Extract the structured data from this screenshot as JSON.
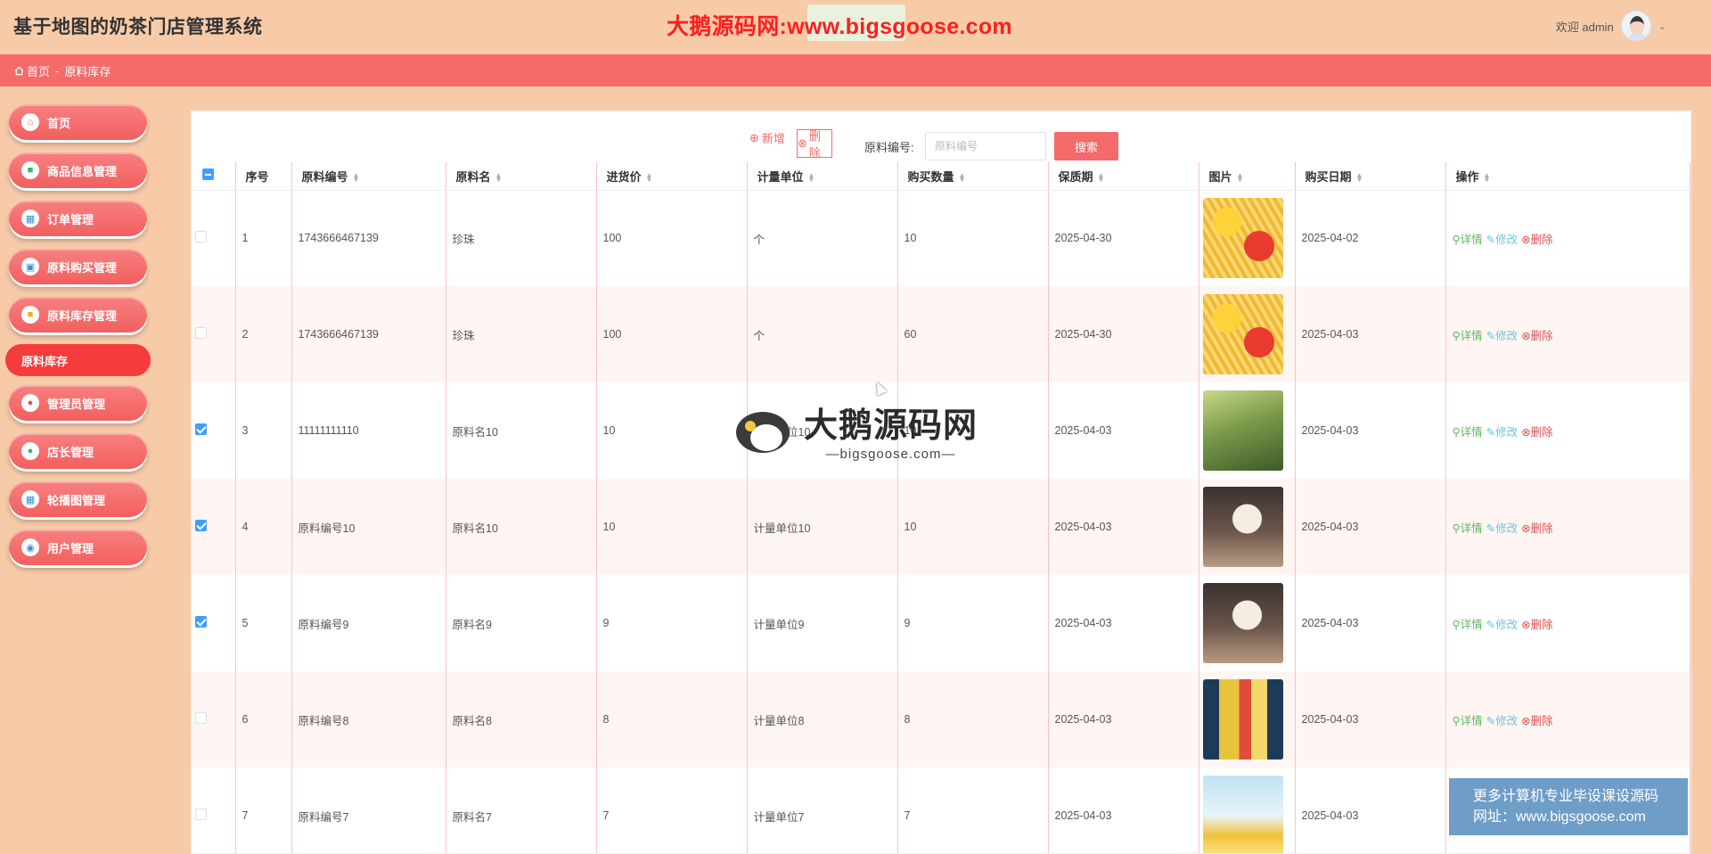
{
  "header": {
    "app_title": "基于地图的奶茶门店管理系统",
    "banner": "大鹅源码网:www.bigsgoose.com",
    "welcome": "欢迎 admin"
  },
  "breadcrumb": {
    "home": "首页",
    "separator": "-",
    "current": "原料库存"
  },
  "sidebar": {
    "items": [
      {
        "label": "首页",
        "icon": "home-icon"
      },
      {
        "label": "商品信息管理",
        "icon": "product-icon"
      },
      {
        "label": "订单管理",
        "icon": "order-icon"
      },
      {
        "label": "原料购买管理",
        "icon": "purchase-icon"
      },
      {
        "label": "原料库存管理",
        "icon": "inventory-icon"
      },
      {
        "label": "管理员管理",
        "icon": "admin-icon"
      },
      {
        "label": "店长管理",
        "icon": "manager-icon"
      },
      {
        "label": "轮播图管理",
        "icon": "carousel-icon"
      },
      {
        "label": "用户管理",
        "icon": "user-icon"
      }
    ],
    "active_sub": "原料库存"
  },
  "toolbar": {
    "add_label": "新增",
    "delete_label": "删除",
    "search_label": "原料编号:",
    "search_placeholder": "原料编号",
    "search_button": "搜索"
  },
  "table": {
    "headers": [
      "序号",
      "原料编号",
      "原料名",
      "进货价",
      "计量单位",
      "购买数量",
      "保质期",
      "图片",
      "购买日期",
      "操作"
    ],
    "rows": [
      {
        "no": "1",
        "code": "1743666467139",
        "name": "珍珠",
        "price": "100",
        "unit": "个",
        "qty": "10",
        "shelf": "2025-04-30",
        "buy_date": "2025-04-02",
        "checked": false,
        "img": "snack"
      },
      {
        "no": "2",
        "code": "1743666467139",
        "name": "珍珠",
        "price": "100",
        "unit": "个",
        "qty": "60",
        "shelf": "2025-04-30",
        "buy_date": "2025-04-03",
        "checked": false,
        "img": "snack"
      },
      {
        "no": "3",
        "code": "11111111110",
        "name": "原料名10",
        "price": "10",
        "unit": "计量单位10",
        "qty": "10",
        "shelf": "2025-04-03",
        "buy_date": "2025-04-03",
        "checked": true,
        "img": "tea-green"
      },
      {
        "no": "4",
        "code": "原料编号10",
        "name": "原料名10",
        "price": "10",
        "unit": "计量单位10",
        "qty": "10",
        "shelf": "2025-04-03",
        "buy_date": "2025-04-03",
        "checked": true,
        "img": "milk-brown"
      },
      {
        "no": "5",
        "code": "原料编号9",
        "name": "原料名9",
        "price": "9",
        "unit": "计量单位9",
        "qty": "9",
        "shelf": "2025-04-03",
        "buy_date": "2025-04-03",
        "checked": true,
        "img": "milk-brown"
      },
      {
        "no": "6",
        "code": "原料编号8",
        "name": "原料名8",
        "price": "8",
        "unit": "计量单位8",
        "qty": "8",
        "shelf": "2025-04-03",
        "buy_date": "2025-04-03",
        "checked": false,
        "img": "fruit-tea"
      },
      {
        "no": "7",
        "code": "原料编号7",
        "name": "原料名7",
        "price": "7",
        "unit": "计量单位7",
        "qty": "7",
        "shelf": "2025-04-03",
        "buy_date": "2025-04-03",
        "checked": false,
        "img": "lemon-tea"
      }
    ],
    "ops": {
      "detail": "详情",
      "edit": "修改",
      "delete": "删除"
    }
  },
  "watermark": {
    "title": "大鹅源码网",
    "url": "—bigsgoose.com—"
  },
  "promo": {
    "line1": "更多计算机专业毕设课设源码",
    "line2": "网址：www.bigsgoose.com"
  },
  "colors": {
    "page_bg": "#f8cba8",
    "accent": "#f56a6a",
    "active": "#f53b3b"
  }
}
